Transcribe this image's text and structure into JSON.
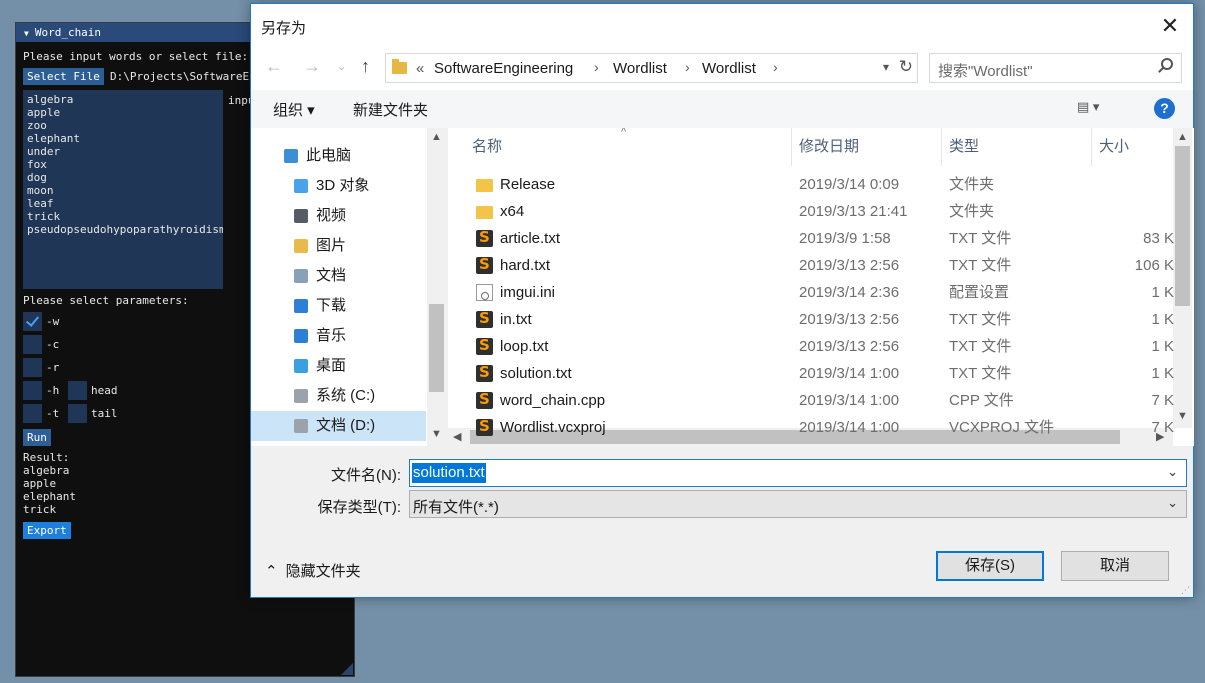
{
  "imgui": {
    "title": "Word_chain",
    "prompt": "Please input words or select file:",
    "select_file_label": "Select File",
    "file_path": "D:\\Projects\\SoftwareEn",
    "input_label": "inpu",
    "words": [
      "algebra",
      "apple",
      "zoo",
      "elephant",
      "under",
      "fox",
      "dog",
      "moon",
      "leaf",
      "trick",
      "pseudopseudohypoparathyroidism"
    ],
    "params_label": "Please select parameters:",
    "params": [
      {
        "flag": "-w",
        "checked": true
      },
      {
        "flag": "-c",
        "checked": false
      },
      {
        "flag": "-r",
        "checked": false
      },
      {
        "flag": "-h",
        "checked": false,
        "input_label": "head"
      },
      {
        "flag": "-t",
        "checked": false,
        "input_label": "tail"
      }
    ],
    "run_label": "Run",
    "result_label": "Result:",
    "result": [
      "algebra",
      "apple",
      "elephant",
      "trick"
    ],
    "export_label": "Export"
  },
  "dialog": {
    "title": "另存为",
    "close_glyph": "✕",
    "nav": {
      "breadcrumb_prefix": "«",
      "crumbs": [
        "SoftwareEngineering",
        "Wordlist",
        "Wordlist"
      ],
      "search_placeholder": "搜索\"Wordlist\""
    },
    "toolbar": {
      "organize": "组织 ▾",
      "new_folder": "新建文件夹",
      "help": "?"
    },
    "tree": [
      {
        "label": "此电脑",
        "color": "#3c8fd6"
      },
      {
        "label": "3D 对象",
        "color": "#4aa3e8"
      },
      {
        "label": "视频",
        "color": "#555c66"
      },
      {
        "label": "图片",
        "color": "#e9b94a"
      },
      {
        "label": "文档",
        "color": "#8aa0b8"
      },
      {
        "label": "下载",
        "color": "#2f7fd6"
      },
      {
        "label": "音乐",
        "color": "#2f7fd6"
      },
      {
        "label": "桌面",
        "color": "#3aa0e0"
      },
      {
        "label": "系统 (C:)",
        "color": "#9aa3ab"
      },
      {
        "label": "文档 (D:)",
        "color": "#9aa3ab",
        "selected": true
      }
    ],
    "columns": [
      "名称",
      "修改日期",
      "类型",
      "大小"
    ],
    "files": [
      {
        "name": "Release",
        "date": "2019/3/14 0:09",
        "type": "文件夹",
        "size": "",
        "icon": "folder"
      },
      {
        "name": "x64",
        "date": "2019/3/13 21:41",
        "type": "文件夹",
        "size": "",
        "icon": "folder"
      },
      {
        "name": "article.txt",
        "date": "2019/3/9 1:58",
        "type": "TXT 文件",
        "size": "83 K",
        "icon": "sublime"
      },
      {
        "name": "hard.txt",
        "date": "2019/3/13 2:56",
        "type": "TXT 文件",
        "size": "106 K",
        "icon": "sublime"
      },
      {
        "name": "imgui.ini",
        "date": "2019/3/14 2:36",
        "type": "配置设置",
        "size": "1 K",
        "icon": "ini"
      },
      {
        "name": "in.txt",
        "date": "2019/3/13 2:56",
        "type": "TXT 文件",
        "size": "1 K",
        "icon": "sublime"
      },
      {
        "name": "loop.txt",
        "date": "2019/3/13 2:56",
        "type": "TXT 文件",
        "size": "1 K",
        "icon": "sublime"
      },
      {
        "name": "solution.txt",
        "date": "2019/3/14 1:00",
        "type": "TXT 文件",
        "size": "1 K",
        "icon": "sublime"
      },
      {
        "name": "word_chain.cpp",
        "date": "2019/3/14 1:00",
        "type": "CPP 文件",
        "size": "7 K",
        "icon": "sublime"
      },
      {
        "name": "Wordlist.vcxproj",
        "date": "2019/3/14 1:00",
        "type": "VCXPROJ 文件",
        "size": "7 K",
        "icon": "sublime"
      }
    ],
    "filename_label": "文件名(N):",
    "filename_value": "solution.txt",
    "filetype_label": "保存类型(T):",
    "filetype_value": "所有文件(*.*)",
    "hide_folders": "隐藏文件夹",
    "save": "保存(S)",
    "cancel": "取消"
  }
}
